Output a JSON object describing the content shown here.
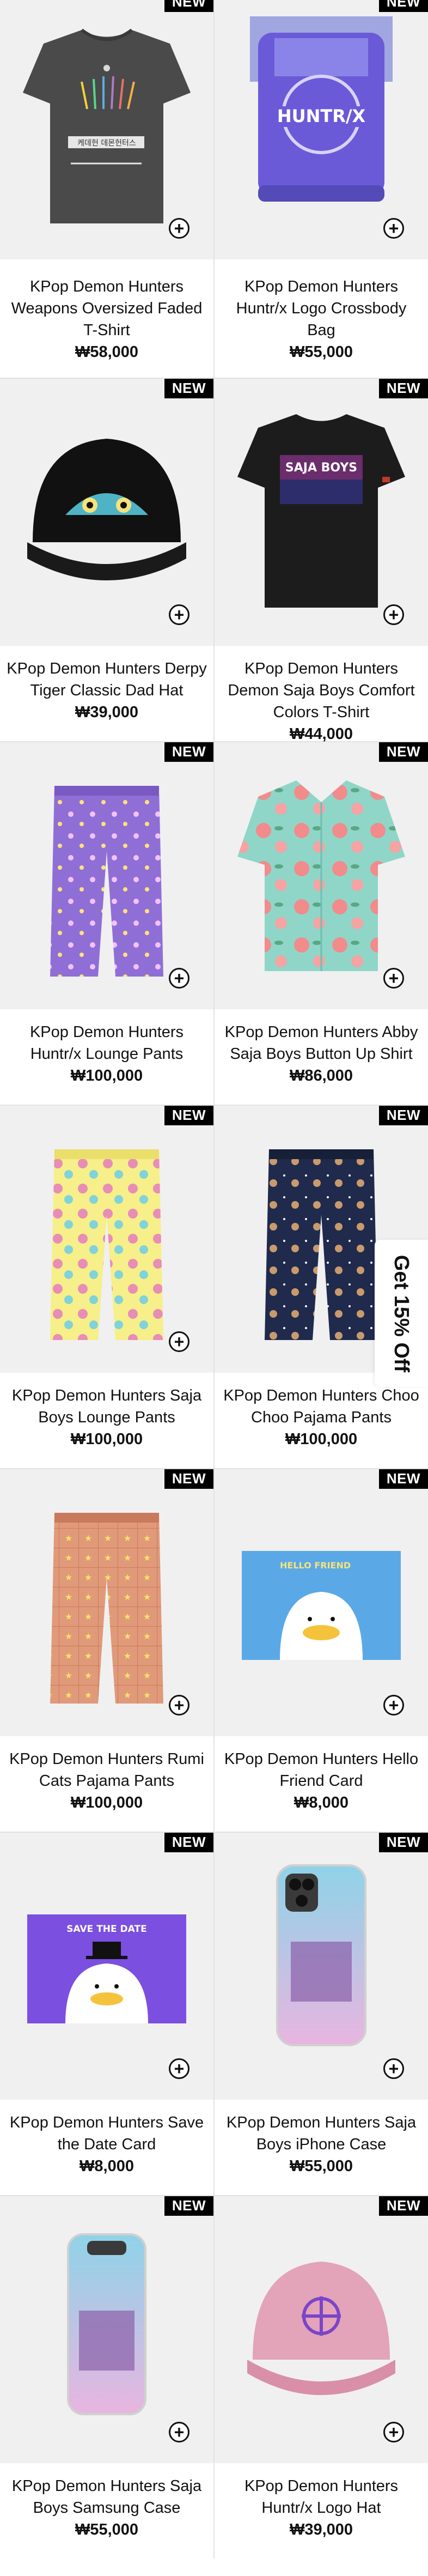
{
  "badge_label": "NEW",
  "promo": {
    "label": "Get 15% Off"
  },
  "products": [
    {
      "title": "KPop Demon Hunters Weapons Oversized Faded T-Shirt",
      "price": "₩58,000",
      "badge": "NEW",
      "art": "tshirt-grey"
    },
    {
      "title": "KPop Demon Hunters Huntr/x Logo Crossbody Bag",
      "price": "₩55,000",
      "badge": "NEW",
      "art": "crossbody-bag"
    },
    {
      "title": "KPop Demon Hunters Derpy Tiger Classic Dad Hat",
      "price": "₩39,000",
      "badge": "NEW",
      "art": "black-hat"
    },
    {
      "title": "KPop Demon Hunters Demon Saja Boys Comfort Colors T-Shirt",
      "price": "₩44,000",
      "badge": "NEW",
      "art": "tshirt-black"
    },
    {
      "title": "KPop Demon Hunters Huntr/x Lounge Pants",
      "price": "₩100,000",
      "badge": "NEW",
      "art": "pants-purple"
    },
    {
      "title": "KPop Demon Hunters Abby Saja Boys Button Up Shirt",
      "price": "₩86,000",
      "badge": "NEW",
      "art": "shirt-floral"
    },
    {
      "title": "KPop Demon Hunters Saja Boys Lounge Pants",
      "price": "₩100,000",
      "badge": "NEW",
      "art": "pants-yellow"
    },
    {
      "title": "KPop Demon Hunters Choo Choo Pajama Pants",
      "price": "₩100,000",
      "badge": "NEW",
      "art": "pants-navy"
    },
    {
      "title": "KPop Demon Hunters Rumi Cats Pajama Pants",
      "price": "₩100,000",
      "badge": "NEW",
      "art": "pants-grid"
    },
    {
      "title": "KPop Demon Hunters Hello Friend Card",
      "price": "₩8,000",
      "badge": "NEW",
      "art": "card-blue"
    },
    {
      "title": "KPop Demon Hunters Save the Date Card",
      "price": "₩8,000",
      "badge": "NEW",
      "art": "card-purple"
    },
    {
      "title": "KPop Demon Hunters Saja Boys iPhone Case",
      "price": "₩55,000",
      "badge": "NEW",
      "art": "iphone-case"
    },
    {
      "title": "KPop Demon Hunters Saja Boys Samsung Case",
      "price": "₩55,000",
      "badge": "NEW",
      "art": "samsung-case"
    },
    {
      "title": "KPop Demon Hunters Huntr/x Logo Hat",
      "price": "₩39,000",
      "badge": "NEW",
      "art": "pink-hat"
    }
  ],
  "card_text": {
    "tshirt_grey": "케데헌 데몬헌터스",
    "bag_logo": "HUNTR/X",
    "tshirt_black": "SAJA BOYS",
    "card_blue": "HELLO FRIEND",
    "card_purple": "SAVE THE DATE"
  },
  "colors": {
    "badge_bg": "#000000",
    "badge_text": "#ffffff",
    "image_bg": "#f0f0f0",
    "grid_line": "#e2e2e2"
  }
}
